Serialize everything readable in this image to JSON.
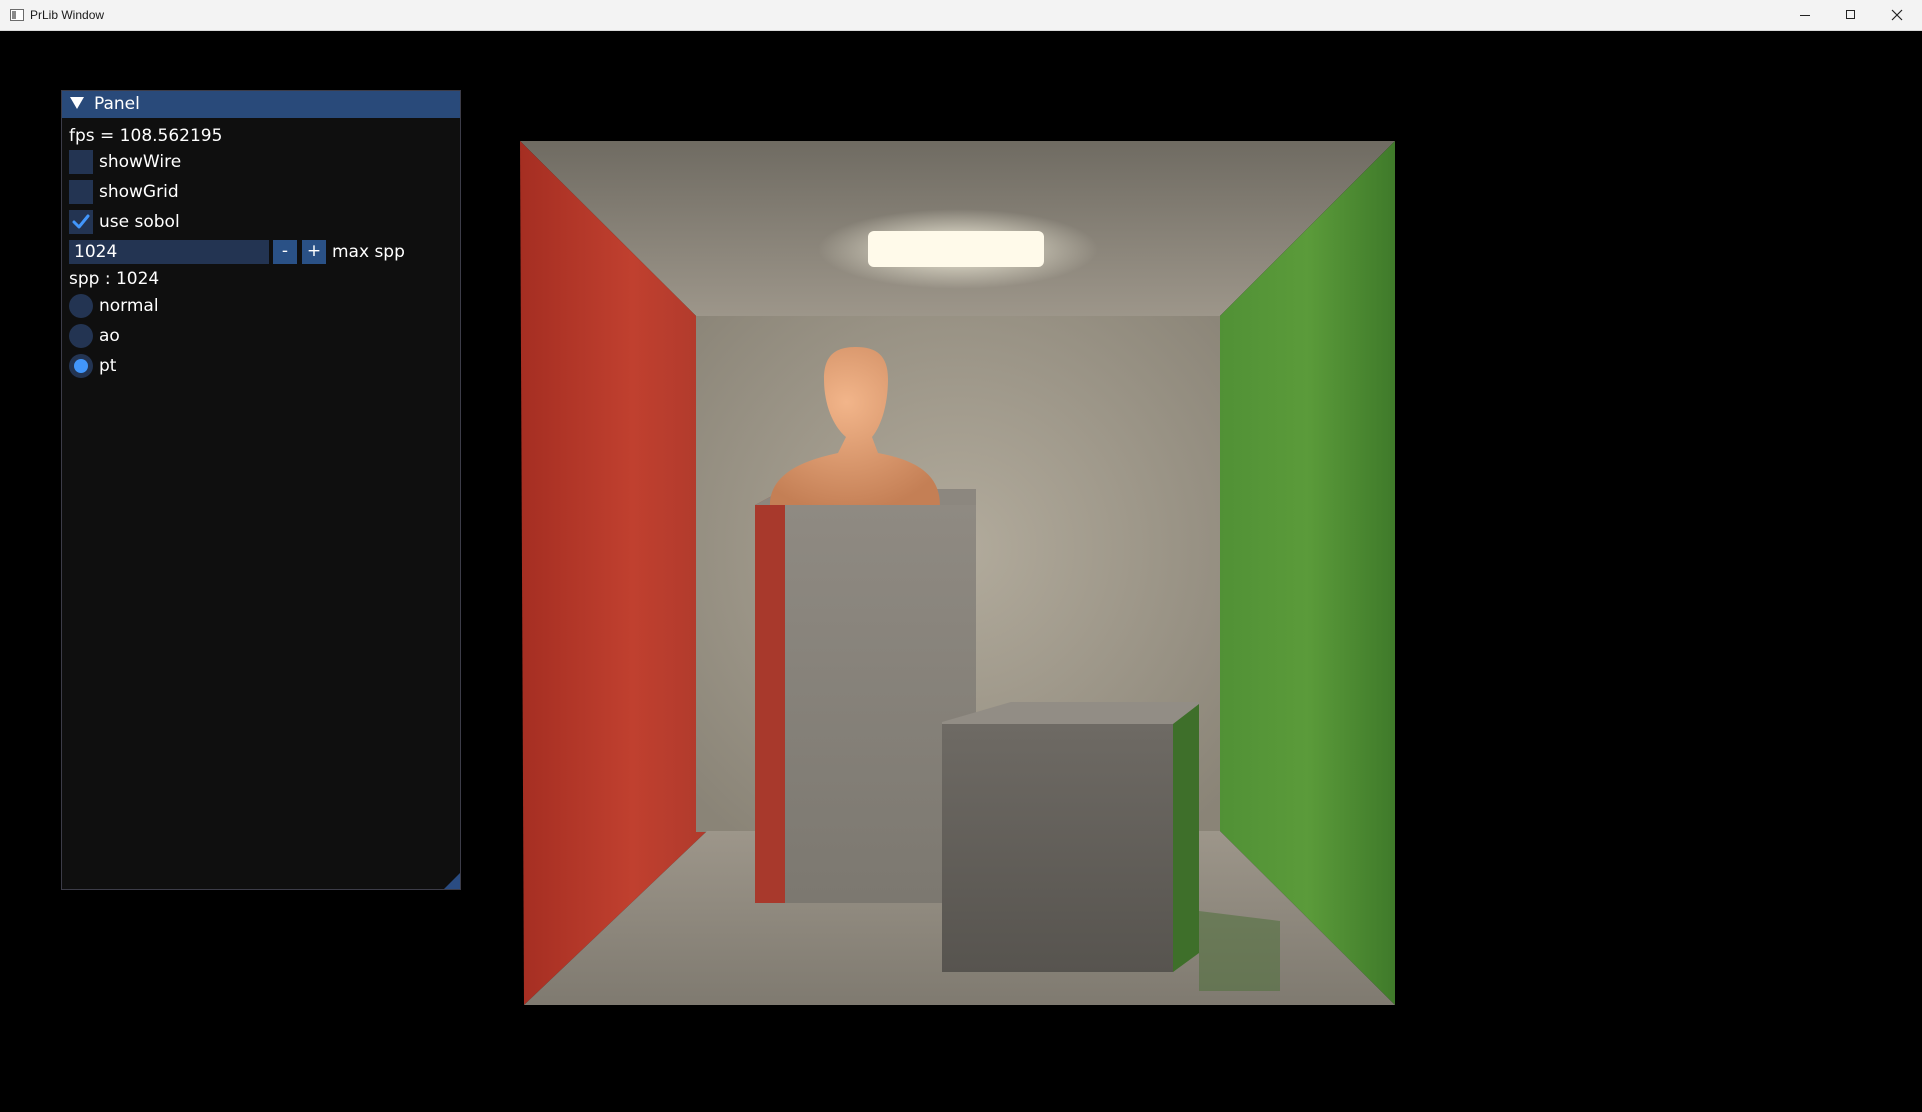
{
  "window": {
    "title": "PrLib Window",
    "icon": "app-window-icon",
    "controls": [
      "minimize-icon",
      "maximize-icon",
      "close-icon"
    ]
  },
  "panel": {
    "title": "Panel",
    "fps_text": "fps = 108.562195",
    "checkboxes": [
      {
        "label": "showWire",
        "checked": false
      },
      {
        "label": "showGrid",
        "checked": false
      },
      {
        "label": "use sobol",
        "checked": true
      }
    ],
    "max_spp": {
      "value": "1024",
      "minus_label": "-",
      "plus_label": "+",
      "label": "max spp"
    },
    "spp_text": "spp : 1024",
    "render_modes": [
      {
        "label": "normal",
        "selected": false
      },
      {
        "label": "ao",
        "selected": false
      },
      {
        "label": "pt",
        "selected": true
      }
    ],
    "colors": {
      "header": "#294a7a",
      "frame": "#233452",
      "button": "#2a5186",
      "accent": "#4296fa",
      "background": "#0f0f0f"
    }
  },
  "scene": {
    "description_icon": "cornell-box-render",
    "colors": {
      "left_wall": "#b83a2c",
      "right_wall": "#4d8f32",
      "back_wall": "#a29b8d",
      "light": "#fff7e2",
      "bust": "#e3a073"
    }
  }
}
